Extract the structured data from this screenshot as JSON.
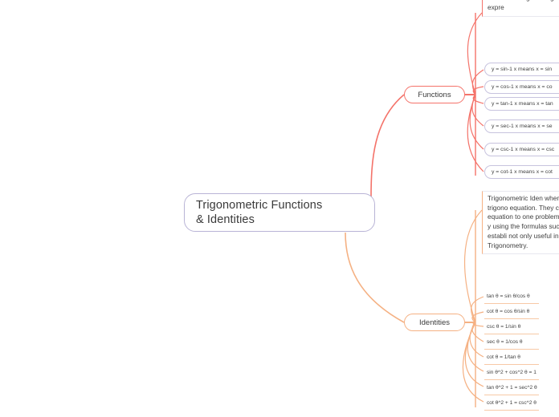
{
  "diagram": {
    "type": "mind-map",
    "central_node": {
      "title_line1": "Trigonometric Functions",
      "title_line2": "& Identities",
      "border_color": "#b9b4d6"
    },
    "branches": [
      {
        "label": "Functions",
        "color": "#f4736a",
        "paragraph": "triangle to the length studying trigonome Formulas aid in pro from degrees to rad understanding and trigonometric expre",
        "children": [
          "y = sin-1 x means x = sin",
          "y = cos-1 x means x = co",
          "y = tan-1 x means x = tan",
          "y = sec-1 x means x = se",
          "y = csc-1 x means x = csc",
          "y = cot-1 x means x = cot"
        ]
      },
      {
        "label": "Identities",
        "color": "#f5b183",
        "paragraph": "Trigonometric Iden whenever a trigono equation. They can an equation to one problem that asks y using the formulas successfully establi not only useful in th Trigonometry.",
        "children": [
          "tan θ = sin θ/cos θ",
          "cot θ = cos θ/sin θ",
          "csc θ = 1/sin θ",
          "sec θ = 1/cos θ",
          "cot θ = 1/tan θ",
          "sin θ^2 + cos^2 θ = 1",
          "tan θ^2 + 1 = sec^2 θ",
          "cot θ^2 + 1 = csc^2 θ"
        ]
      }
    ]
  }
}
